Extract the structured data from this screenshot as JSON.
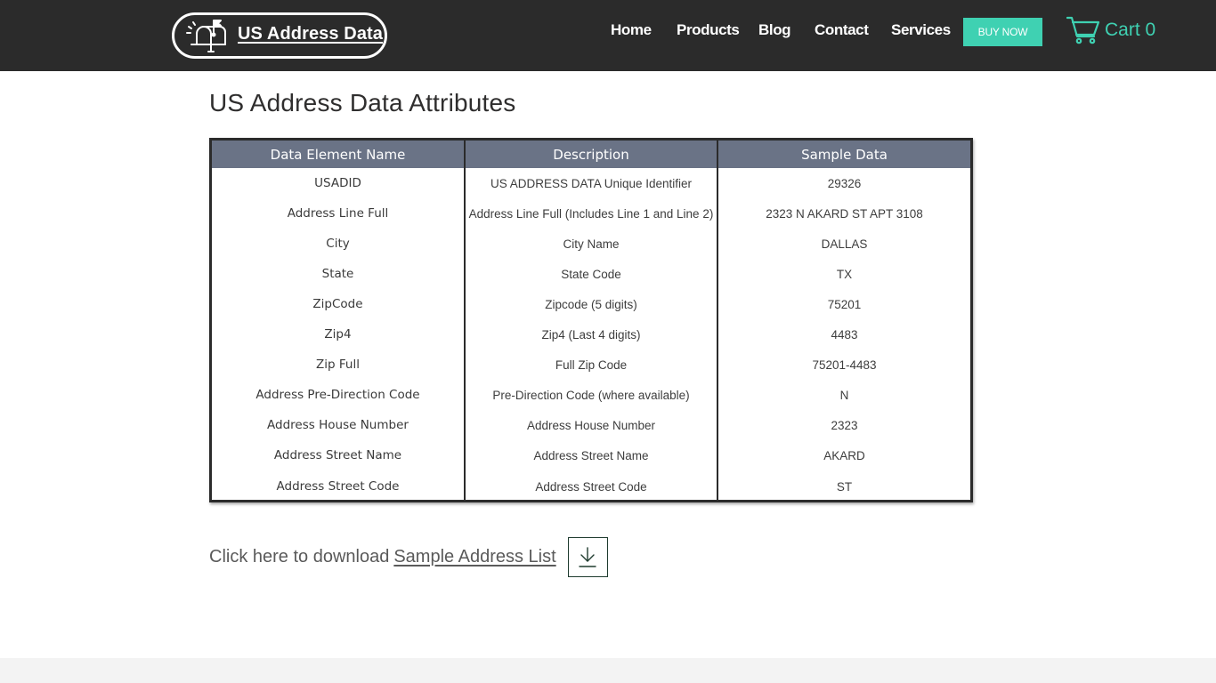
{
  "header": {
    "logo_text": "US Address Data",
    "logo_icon": "mailbox-icon",
    "nav": [
      {
        "label": "Home"
      },
      {
        "label": "Products"
      },
      {
        "label": "Blog"
      },
      {
        "label": "Contact"
      },
      {
        "label": "Services"
      }
    ],
    "buy_now_label": "BUY NOW",
    "cart_label": "Cart",
    "cart_count": "0",
    "accent_color": "#3fd1b2",
    "background_color": "#2b2b2b"
  },
  "main": {
    "title": "US Address Data Attributes",
    "table": {
      "header_color": "#6a7386",
      "columns": [
        "Data Element Name",
        "Description",
        "Sample Data"
      ],
      "rows": [
        [
          "USADID",
          "US ADDRESS DATA Unique Identifier",
          "29326"
        ],
        [
          "Address Line Full",
          "Address Line Full (Includes Line 1 and Line 2)",
          "2323 N AKARD ST APT 3108"
        ],
        [
          "City",
          "City Name",
          "DALLAS"
        ],
        [
          "State",
          "State Code",
          "TX"
        ],
        [
          "ZipCode",
          "Zipcode (5 digits)",
          "75201"
        ],
        [
          "Zip4",
          "Zip4 (Last 4 digits)",
          "4483"
        ],
        [
          "Zip Full",
          "Full Zip Code",
          "75201-4483"
        ],
        [
          "Address Pre-Direction Code",
          "Pre-Direction Code (where available)",
          "N"
        ],
        [
          "Address House Number",
          "Address House Number",
          "2323"
        ],
        [
          "Address Street Name",
          "Address Street Name",
          "AKARD"
        ],
        [
          "Address Street Code",
          "Address Street Code",
          "ST"
        ]
      ]
    },
    "download": {
      "prefix_text": "Click here to download",
      "link_text": "Sample Address List",
      "icon": "download-icon"
    }
  }
}
